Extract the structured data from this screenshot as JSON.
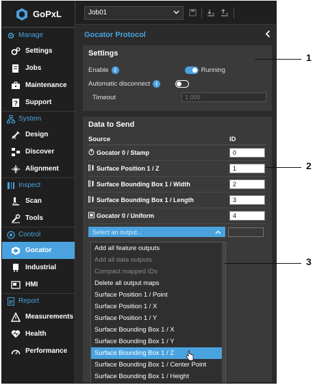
{
  "brand": {
    "name": "GoPxL"
  },
  "sidebar": {
    "sections": [
      {
        "label": "Manage",
        "items": [
          {
            "label": "Settings"
          },
          {
            "label": "Jobs"
          },
          {
            "label": "Maintenance"
          },
          {
            "label": "Support"
          }
        ]
      },
      {
        "label": "System",
        "items": [
          {
            "label": "Design"
          },
          {
            "label": "Discover"
          },
          {
            "label": "Alignment"
          }
        ]
      },
      {
        "label": "Inspect",
        "items": [
          {
            "label": "Scan"
          },
          {
            "label": "Tools"
          }
        ]
      },
      {
        "label": "Control",
        "items": [
          {
            "label": "Gocator"
          },
          {
            "label": "Industrial"
          },
          {
            "label": "HMI"
          }
        ]
      },
      {
        "label": "Report",
        "items": [
          {
            "label": "Measurements"
          },
          {
            "label": "Health"
          },
          {
            "label": "Performance"
          }
        ]
      }
    ],
    "active_item": "Gocator"
  },
  "toolbar": {
    "job": "Job01"
  },
  "panel": {
    "title": "Gocator Protocol"
  },
  "settings": {
    "title": "Settings",
    "enable_label": "Enable",
    "enable_status": "Running",
    "auto_disconnect_label": "Automatic disconnect",
    "timeout_label": "Timeout",
    "timeout_value": "1.000"
  },
  "data_to_send": {
    "title": "Data to Send",
    "col_source": "Source",
    "col_id": "ID",
    "rows": [
      {
        "source": "Gocator 0 / Stamp",
        "id": "0",
        "icon": "stamp-icon"
      },
      {
        "source": "Surface Position 1 / Z",
        "id": "1",
        "icon": "measurement-icon"
      },
      {
        "source": "Surface Bounding Box 1 / Width",
        "id": "2",
        "icon": "measurement-icon"
      },
      {
        "source": "Surface Bounding Box 1 / Length",
        "id": "3",
        "icon": "measurement-icon"
      },
      {
        "source": "Gocator 0 / Uniform",
        "id": "4",
        "icon": "surface-icon"
      }
    ],
    "select_placeholder": "Select an output..."
  },
  "dropdown": {
    "options": [
      {
        "label": "Add all feature outputs",
        "disabled": false
      },
      {
        "label": "Add all data outputs",
        "disabled": true
      },
      {
        "label": "Compact mapped IDs",
        "disabled": true
      },
      {
        "label": "Delete all output maps",
        "disabled": false
      },
      {
        "label": "Surface Position 1 / Point",
        "disabled": false
      },
      {
        "label": "Surface Position 1 / X",
        "disabled": false
      },
      {
        "label": "Surface Position 1 / Y",
        "disabled": false
      },
      {
        "label": "Surface Bounding Box 1 / X",
        "disabled": false
      },
      {
        "label": "Surface Bounding Box 1 / Y",
        "disabled": false
      },
      {
        "label": "Surface Bounding Box 1 / Z",
        "disabled": false
      },
      {
        "label": "Surface Bounding Box 1 / Center Point",
        "disabled": false
      },
      {
        "label": "Surface Bounding Box 1 / Height",
        "disabled": false
      }
    ],
    "hovered": "Surface Bounding Box 1 / Z"
  },
  "callouts": [
    "1",
    "2",
    "3"
  ],
  "colors": {
    "accent": "#4aa3df",
    "bg": "#2b2b2b",
    "card": "#3a3a3a"
  }
}
